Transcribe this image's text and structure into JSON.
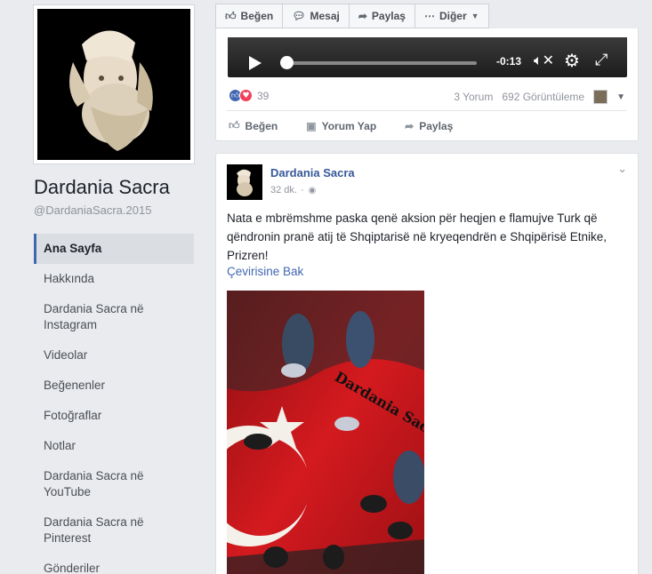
{
  "page": {
    "name": "Dardania Sacra",
    "handle": "@DardaniaSacra.2015"
  },
  "nav": [
    {
      "label": "Ana Sayfa",
      "active": true
    },
    {
      "label": "Hakkında"
    },
    {
      "label": "Dardania Sacra në Instagram"
    },
    {
      "label": "Videolar"
    },
    {
      "label": "Beğenenler"
    },
    {
      "label": "Fotoğraflar"
    },
    {
      "label": "Notlar"
    },
    {
      "label": "Dardania Sacra në YouTube"
    },
    {
      "label": "Dardania Sacra në Pinterest"
    },
    {
      "label": "Gönderiler"
    }
  ],
  "actionbar": {
    "like": "Beğen",
    "message": "Mesaj",
    "share": "Paylaş",
    "more": "Diğer"
  },
  "post1": {
    "video_time": "-0:13",
    "video_progress": 0.0,
    "reaction_count": "39",
    "comments": "3 Yorum",
    "views": "692 Görüntüleme",
    "actions": {
      "like": "Beğen",
      "comment": "Yorum Yap",
      "share": "Paylaş"
    }
  },
  "post2": {
    "author": "Dardania Sacra",
    "time": "32 dk.",
    "separator": "·",
    "text": "Nata e mbrëmshme paska qenë aksion për heqjen e flamujve Turk që qëndronin pranë atij të Shqiptarisë në kryeqendrën e Shqipërisë Etnike, Prizren!",
    "translate": "Çevirisine Bak",
    "watermark": "Dardania Sacra"
  },
  "colors": {
    "brand_blue": "#4267b2",
    "link_blue": "#365899",
    "flag_red": "#c8181c"
  }
}
